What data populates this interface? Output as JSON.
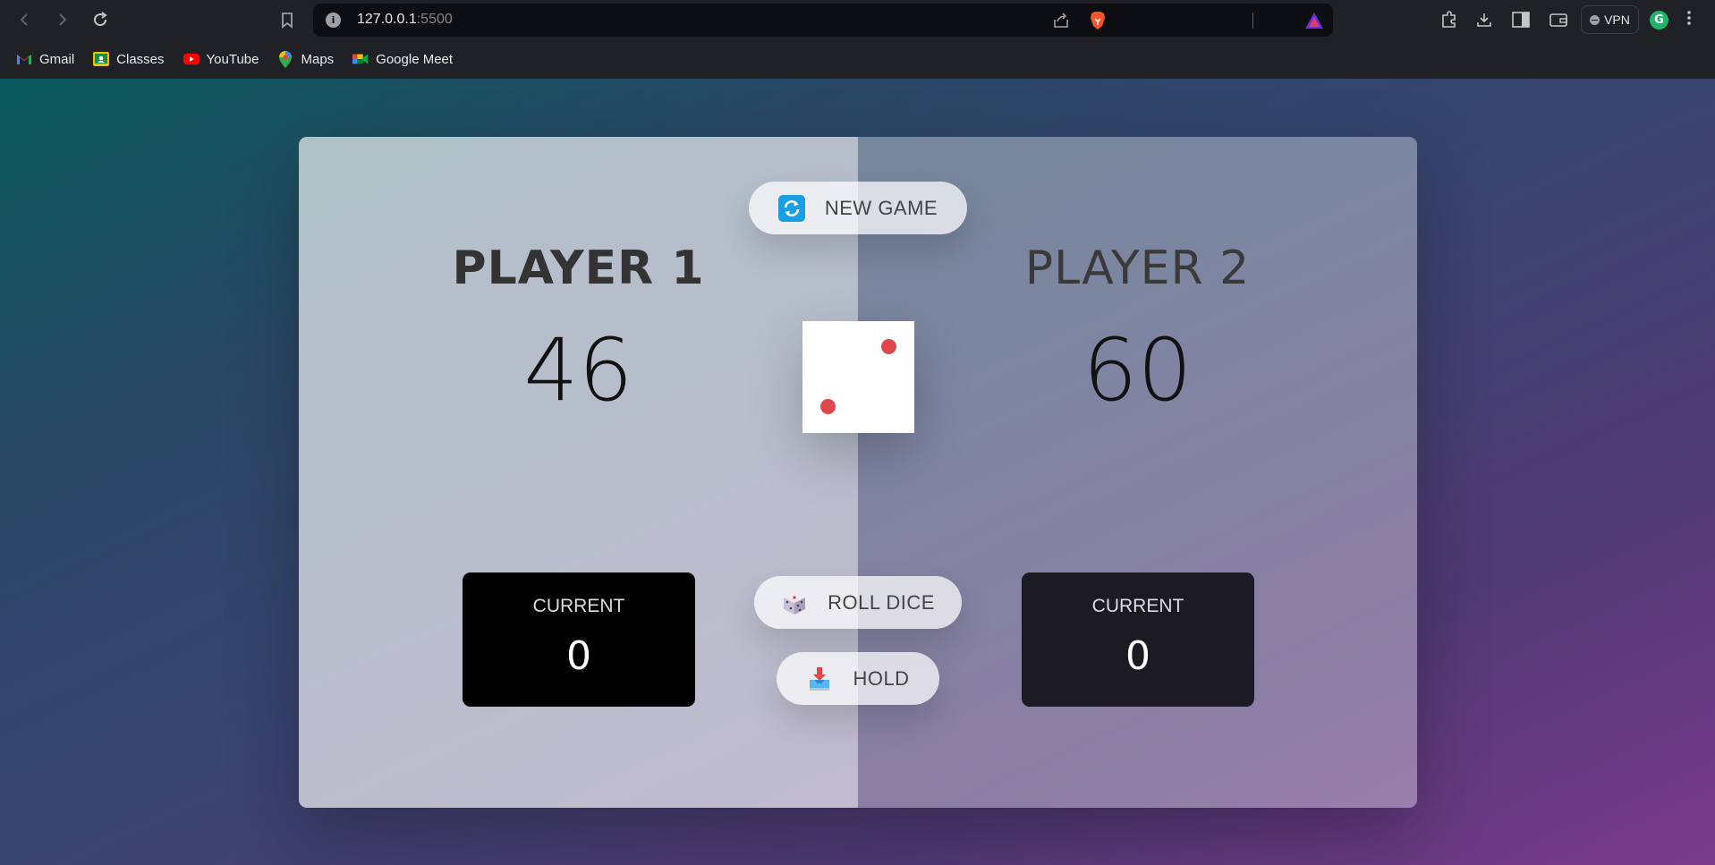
{
  "browser": {
    "url_host": "127.0.0.1",
    "url_port": ":5500",
    "vpn_label": "VPN",
    "profile_initial": "G",
    "bookmarks": [
      {
        "label": "Gmail",
        "icon": "gmail-icon"
      },
      {
        "label": "Classes",
        "icon": "classes-icon"
      },
      {
        "label": "YouTube",
        "icon": "youtube-icon"
      },
      {
        "label": "Maps",
        "icon": "maps-icon"
      },
      {
        "label": "Google Meet",
        "icon": "google-meet-icon"
      }
    ]
  },
  "game": {
    "new_game_label": "NEW GAME",
    "roll_dice_label": "ROLL DICE",
    "hold_label": "HOLD",
    "dice_value": 2,
    "active_player": 1,
    "players": [
      {
        "name": "PLAYER 1",
        "score": "46",
        "current_label": "CURRENT",
        "current_score": "0"
      },
      {
        "name": "PLAYER 2",
        "score": "60",
        "current_label": "CURRENT",
        "current_score": "0"
      }
    ]
  },
  "colors": {
    "pip": "#e0474c",
    "active_panel": "rgba(255,255,255,0.65)",
    "inactive_panel": "rgba(255,255,255,0.35)"
  }
}
